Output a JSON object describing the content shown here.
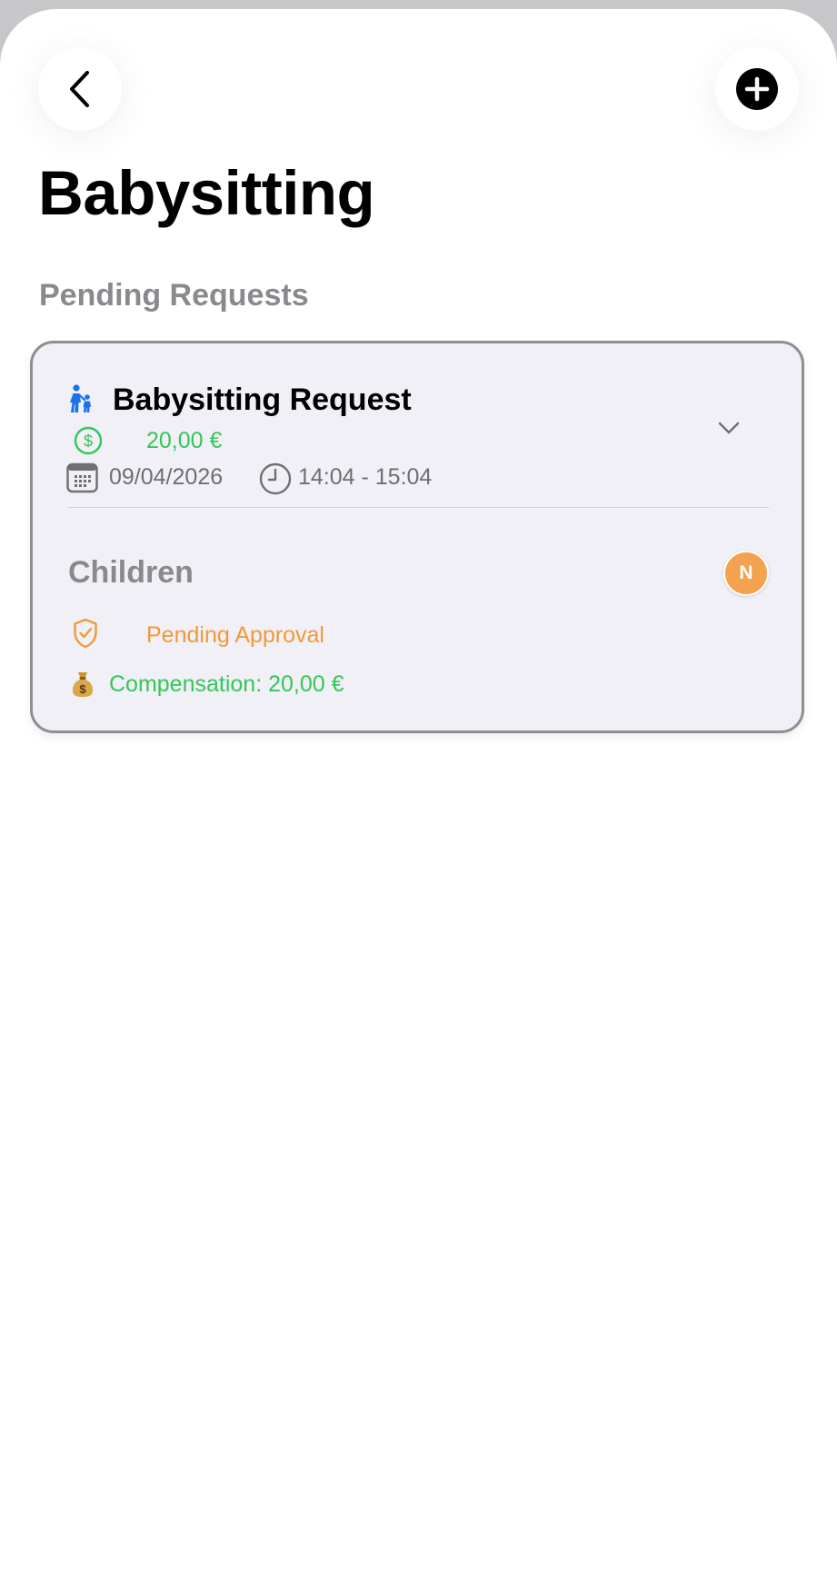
{
  "header": {
    "title": "Babysitting",
    "back_icon": "chevron-left-icon",
    "add_icon": "plus-circle-icon"
  },
  "section": {
    "title": "Pending Requests"
  },
  "request_card": {
    "title": "Babysitting Request",
    "title_icon": "parent-child-icon",
    "price": "20,00 €",
    "price_icon": "dollar-circle-icon",
    "date": "09/04/2026",
    "date_icon": "calendar-icon",
    "time": "14:04 - 15:04",
    "time_icon": "clock-icon",
    "expand_icon": "chevron-down-icon",
    "children_label": "Children",
    "child_avatar_initial": "N",
    "status": "Pending Approval",
    "status_icon": "shield-check-icon",
    "compensation": "Compensation: 20,00 €",
    "compensation_icon": "money-bag-icon"
  },
  "colors": {
    "accent_green": "#34c759",
    "status_orange": "#f09a37",
    "avatar_orange": "#f3a24f",
    "icon_blue": "#1a73e8",
    "card_background": "#f0f0f6",
    "card_border": "#8e8e93"
  }
}
